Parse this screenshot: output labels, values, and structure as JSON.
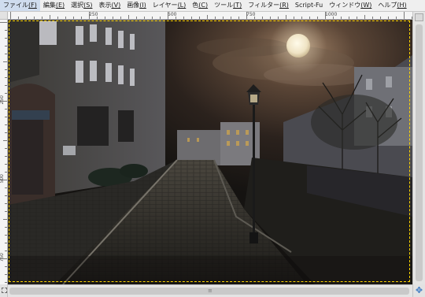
{
  "menubar": {
    "items": [
      {
        "label": "ファイル",
        "key": "(F)"
      },
      {
        "label": "編集",
        "key": "(E)"
      },
      {
        "label": "選択",
        "key": "(S)"
      },
      {
        "label": "表示",
        "key": "(V)"
      },
      {
        "label": "画像",
        "key": "(I)"
      },
      {
        "label": "レイヤー",
        "key": "(L)"
      },
      {
        "label": "色",
        "key": "(C)"
      },
      {
        "label": "ツール",
        "key": "(T)"
      },
      {
        "label": "フィルター",
        "key": "(R)"
      },
      {
        "label": "Script-Fu",
        "key": ""
      },
      {
        "label": "ウィンドウ",
        "key": "(W)"
      },
      {
        "label": "ヘルプ",
        "key": "(H)"
      }
    ]
  },
  "rulers": {
    "horizontal_labels": [
      "250",
      "500",
      "750",
      "1000"
    ],
    "vertical_labels": [
      "250",
      "500",
      "750"
    ]
  },
  "canvas": {
    "image_description_icon": "night-street-photo",
    "border_color": "#ffd400"
  },
  "icons": {
    "quick_mask": "quick-mask-icon",
    "navigate": "navigate-icon",
    "navigate_glyph": "✥",
    "scroll_grip": "≡"
  },
  "colors": {
    "menubar_bg": "#efefef",
    "canvas_bg": "#5f5f5f",
    "accent": "#3a78c2"
  }
}
